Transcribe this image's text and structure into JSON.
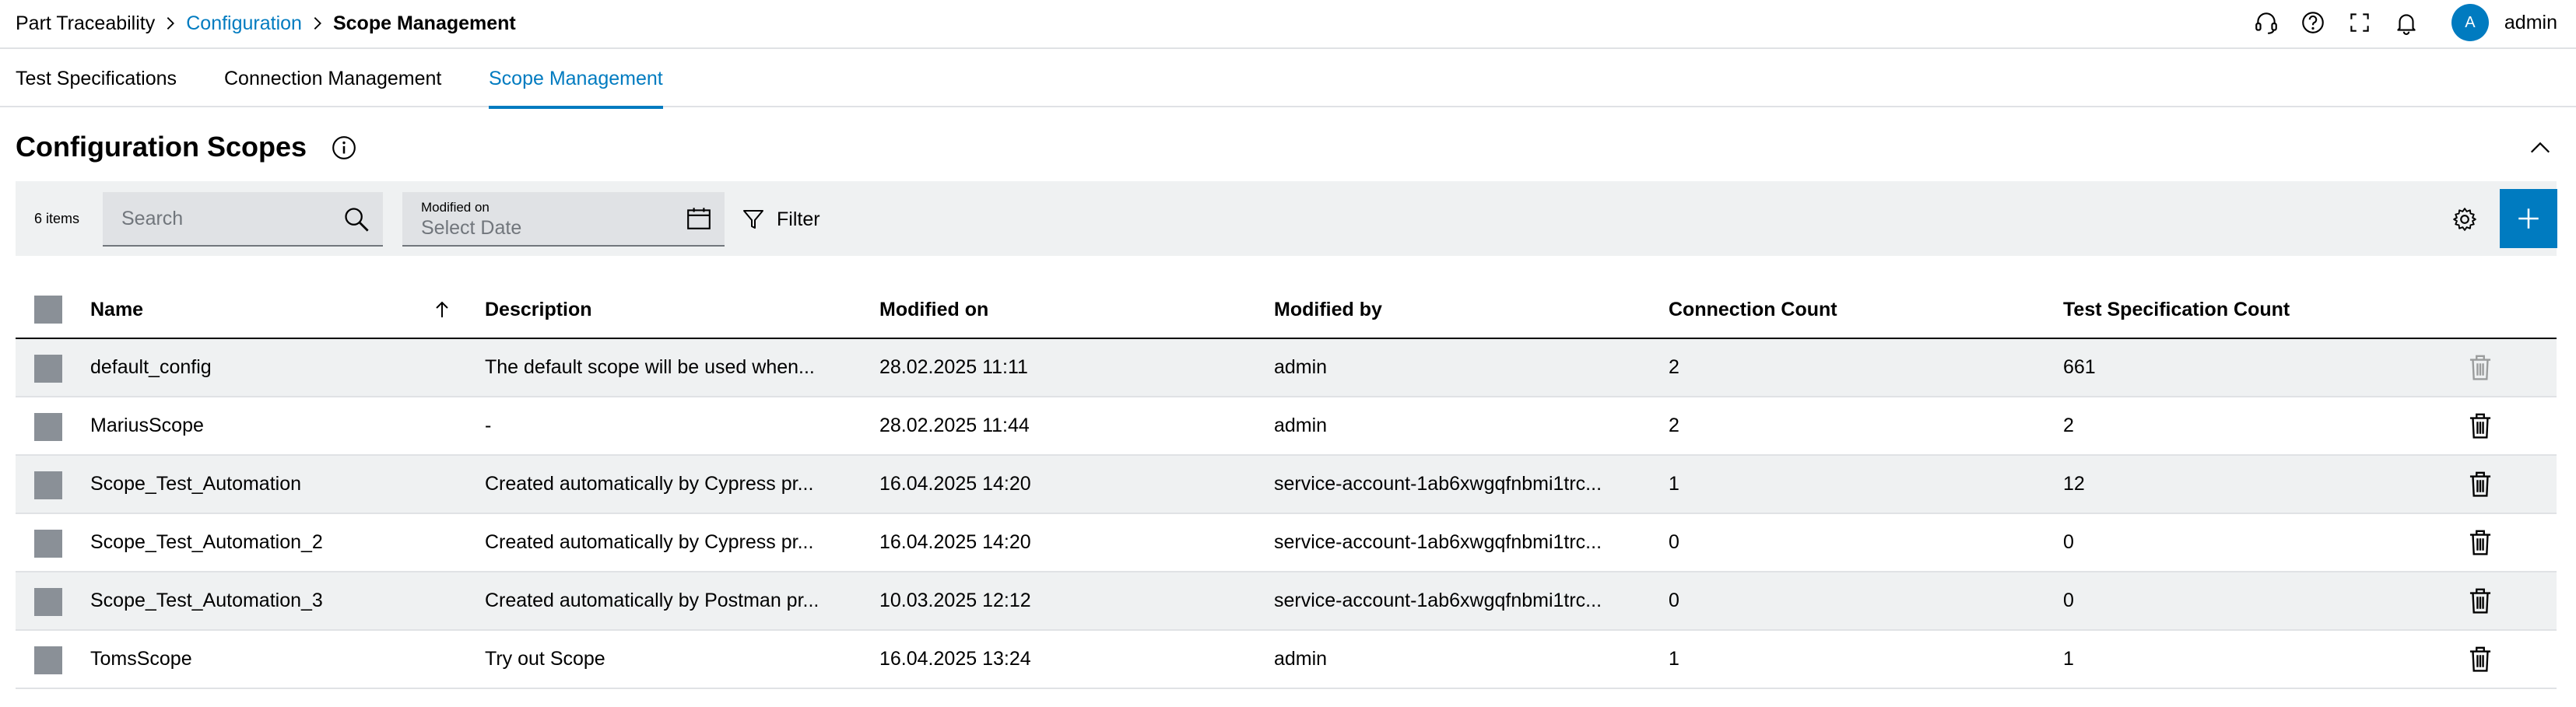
{
  "breadcrumb": {
    "root": "Part Traceability",
    "parent": "Configuration",
    "current": "Scope Management"
  },
  "header": {
    "user_initial": "A",
    "user_name": "admin",
    "icons": [
      "headset-icon",
      "help-icon",
      "fullscreen-icon",
      "bell-icon"
    ]
  },
  "tabs": [
    {
      "label": "Test Specifications",
      "active": false
    },
    {
      "label": "Connection Management",
      "active": false
    },
    {
      "label": "Scope Management",
      "active": true
    }
  ],
  "section": {
    "title": "Configuration Scopes"
  },
  "toolbar": {
    "item_count": "6 items",
    "search_placeholder": "Search",
    "date_label": "Modified on",
    "date_placeholder": "Select Date",
    "filter_label": "Filter"
  },
  "table": {
    "columns": [
      "Name",
      "Description",
      "Modified on",
      "Modified by",
      "Connection Count",
      "Test Specification Count"
    ],
    "rows": [
      {
        "name": "default_config",
        "description": "The default scope will be used when...",
        "modified_on": "28.02.2025 11:11",
        "modified_by": "admin",
        "connection_count": "2",
        "test_spec_count": "661",
        "delete_disabled": true
      },
      {
        "name": "MariusScope",
        "description": "-",
        "modified_on": "28.02.2025 11:44",
        "modified_by": "admin",
        "connection_count": "2",
        "test_spec_count": "2",
        "delete_disabled": false
      },
      {
        "name": "Scope_Test_Automation",
        "description": "Created automatically by Cypress pr...",
        "modified_on": "16.04.2025 14:20",
        "modified_by": "service-account-1ab6xwgqfnbmi1trc...",
        "connection_count": "1",
        "test_spec_count": "12",
        "delete_disabled": false
      },
      {
        "name": "Scope_Test_Automation_2",
        "description": "Created automatically by Cypress pr...",
        "modified_on": "16.04.2025 14:20",
        "modified_by": "service-account-1ab6xwgqfnbmi1trc...",
        "connection_count": "0",
        "test_spec_count": "0",
        "delete_disabled": false
      },
      {
        "name": "Scope_Test_Automation_3",
        "description": "Created automatically by Postman pr...",
        "modified_on": "10.03.2025 12:12",
        "modified_by": "service-account-1ab6xwgqfnbmi1trc...",
        "connection_count": "0",
        "test_spec_count": "0",
        "delete_disabled": false
      },
      {
        "name": "TomsScope",
        "description": "Try out Scope",
        "modified_on": "16.04.2025 13:24",
        "modified_by": "admin",
        "connection_count": "1",
        "test_spec_count": "1",
        "delete_disabled": false
      }
    ]
  },
  "colors": {
    "accent": "#007bc0",
    "toolbar_bg": "#eff1f2",
    "field_bg": "#e0e2e5",
    "checkbox": "#8a9097"
  }
}
